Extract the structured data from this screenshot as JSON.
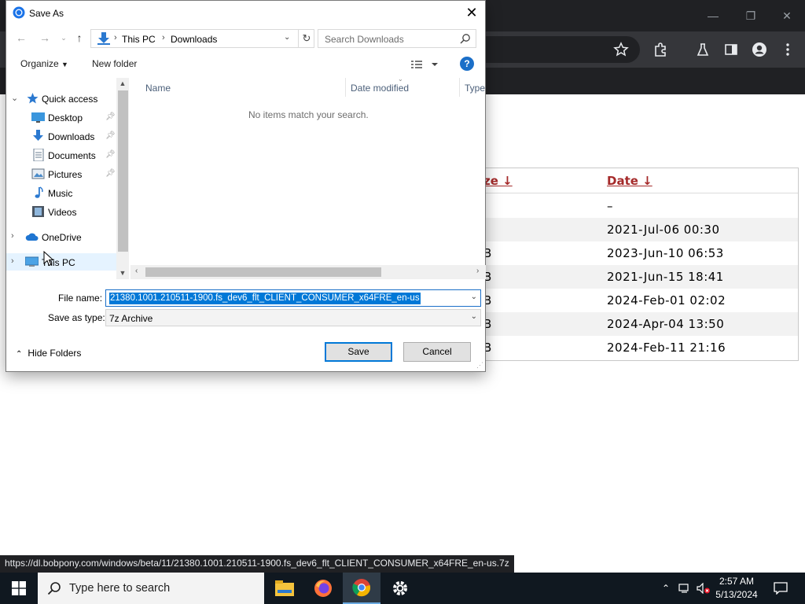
{
  "dialog": {
    "title": "Save As",
    "close_glyph": "✕",
    "breadcrumb": [
      "This PC",
      "Downloads"
    ],
    "search_placeholder": "Search Downloads",
    "organize_label": "Organize",
    "new_folder_label": "New folder",
    "help_glyph": "?",
    "nav_tree": [
      {
        "label": "Quick access",
        "icon": "star-icon",
        "expanded": true
      },
      {
        "label": "Desktop",
        "icon": "desktop-icon",
        "pinned": true
      },
      {
        "label": "Downloads",
        "icon": "download-icon",
        "pinned": true
      },
      {
        "label": "Documents",
        "icon": "documents-icon",
        "pinned": true
      },
      {
        "label": "Pictures",
        "icon": "pictures-icon",
        "pinned": true
      },
      {
        "label": "Music",
        "icon": "music-icon"
      },
      {
        "label": "Videos",
        "icon": "videos-icon"
      },
      {
        "label": "OneDrive",
        "icon": "cloud-icon"
      },
      {
        "label": "This PC",
        "icon": "computer-icon",
        "selected": true
      }
    ],
    "columns": [
      "Name",
      "Date modified",
      "Type"
    ],
    "empty_message": "No items match your search.",
    "file_name_label": "File name:",
    "file_name_value": "21380.1001.210511-1900.fs_dev6_flt_CLIENT_CONSUMER_x64FRE_en-us",
    "save_type_label": "Save as type:",
    "save_type_value": "7z Archive",
    "hide_folders_label": "Hide Folders",
    "save_label": "Save",
    "cancel_label": "Cancel"
  },
  "listing": {
    "headers": {
      "size": "ze ↓",
      "date": "Date ↓"
    },
    "rows": [
      {
        "size": "",
        "date": "–"
      },
      {
        "size": "",
        "date": "2021-Jul-06 00:30"
      },
      {
        "size": "B",
        "date": "2023-Jun-10 06:53"
      },
      {
        "size": "B",
        "date": "2021-Jun-15 18:41"
      },
      {
        "size": "B",
        "date": "2024-Feb-01 02:02"
      },
      {
        "size": "B",
        "date": "2024-Apr-04 13:50"
      },
      {
        "size": "B",
        "date": "2024-Feb-11 21:16"
      }
    ]
  },
  "status_url": "https://dl.bobpony.com/windows/beta/11/21380.1001.210511-1900.fs_dev6_flt_CLIENT_CONSUMER_x64FRE_en-us.7z",
  "taskbar": {
    "search_placeholder": "Type here to search",
    "apps": [
      "file-explorer-icon",
      "firefox-icon",
      "chrome-icon",
      "settings-icon"
    ],
    "time": "2:57 AM",
    "date": "5/13/2024"
  },
  "colors": {
    "accent": "#0078d7",
    "link_header": "#a52a2a",
    "browser_dark": "#202124",
    "taskbar": "#101820"
  }
}
